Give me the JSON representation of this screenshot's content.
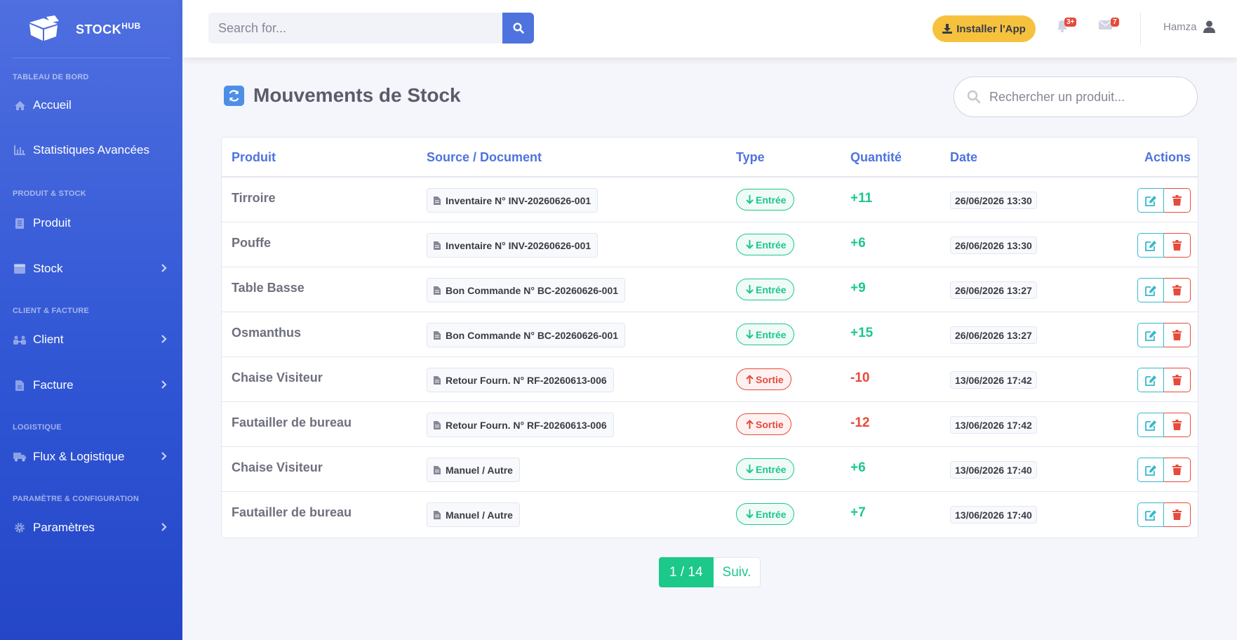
{
  "brand": {
    "name": "STOCK",
    "sup": "HUB"
  },
  "sidebar": {
    "sections": [
      {
        "heading": "TABLEAU DE BORD"
      },
      {
        "heading": "PRODUIT & STOCK"
      },
      {
        "heading": "CLIENT & FACTURE"
      },
      {
        "heading": "LOGISTIQUE"
      },
      {
        "heading": "PARAMÈTRE & CONFIGURATION"
      }
    ],
    "items": [
      {
        "label": "Accueil",
        "icon": "home-icon"
      },
      {
        "label": "Statistiques Avancées",
        "icon": "chart-icon"
      },
      {
        "label": "Produit",
        "icon": "list-icon"
      },
      {
        "label": "Stock",
        "icon": "box-icon"
      },
      {
        "label": "Client",
        "icon": "users-icon"
      },
      {
        "label": "Facture",
        "icon": "file-icon"
      },
      {
        "label": "Flux & Logistique",
        "icon": "truck-icon"
      },
      {
        "label": "Paramètres",
        "icon": "gear-icon"
      }
    ]
  },
  "topbar": {
    "search_placeholder": "Search for...",
    "install_label": "Installer l'App",
    "alerts_badge": "3+",
    "messages_badge": "7",
    "user_name": "Hamza"
  },
  "page": {
    "title": "Mouvements de Stock",
    "product_search_placeholder": "Rechercher un produit..."
  },
  "table": {
    "headers": {
      "product": "Produit",
      "source": "Source / Document",
      "type": "Type",
      "quantity": "Quantité",
      "date": "Date",
      "actions": "Actions"
    },
    "rows": [
      {
        "product": "Tirroire",
        "source": "Inventaire N° INV-20260626-001",
        "type": "Entrée",
        "direction": "in",
        "qty": "+11",
        "date": "26/06/2026 13:30"
      },
      {
        "product": "Pouffe",
        "source": "Inventaire N° INV-20260626-001",
        "type": "Entrée",
        "direction": "in",
        "qty": "+6",
        "date": "26/06/2026 13:30"
      },
      {
        "product": "Table Basse",
        "source": "Bon Commande N° BC-20260626-001",
        "type": "Entrée",
        "direction": "in",
        "qty": "+9",
        "date": "26/06/2026 13:27"
      },
      {
        "product": "Osmanthus",
        "source": "Bon Commande N° BC-20260626-001",
        "type": "Entrée",
        "direction": "in",
        "qty": "+15",
        "date": "26/06/2026 13:27"
      },
      {
        "product": "Chaise Visiteur",
        "source": "Retour Fourn. N° RF-20260613-006",
        "type": "Sortie",
        "direction": "out",
        "qty": "-10",
        "date": "13/06/2026 17:42"
      },
      {
        "product": "Fautailler de bureau",
        "source": "Retour Fourn. N° RF-20260613-006",
        "type": "Sortie",
        "direction": "out",
        "qty": "-12",
        "date": "13/06/2026 17:42"
      },
      {
        "product": "Chaise Visiteur",
        "source": "Manuel / Autre",
        "type": "Entrée",
        "direction": "in",
        "qty": "+6",
        "date": "13/06/2026 17:40"
      },
      {
        "product": "Fautailler de bureau",
        "source": "Manuel / Autre",
        "type": "Entrée",
        "direction": "in",
        "qty": "+7",
        "date": "13/06/2026 17:40"
      }
    ]
  },
  "pagination": {
    "current": "1 / 14",
    "next_label": "Suiv."
  },
  "colors": {
    "primary": "#4e73df",
    "success": "#1cc88a",
    "danger": "#e74a3b",
    "warning": "#f6c23e",
    "info": "#36b9cc"
  }
}
